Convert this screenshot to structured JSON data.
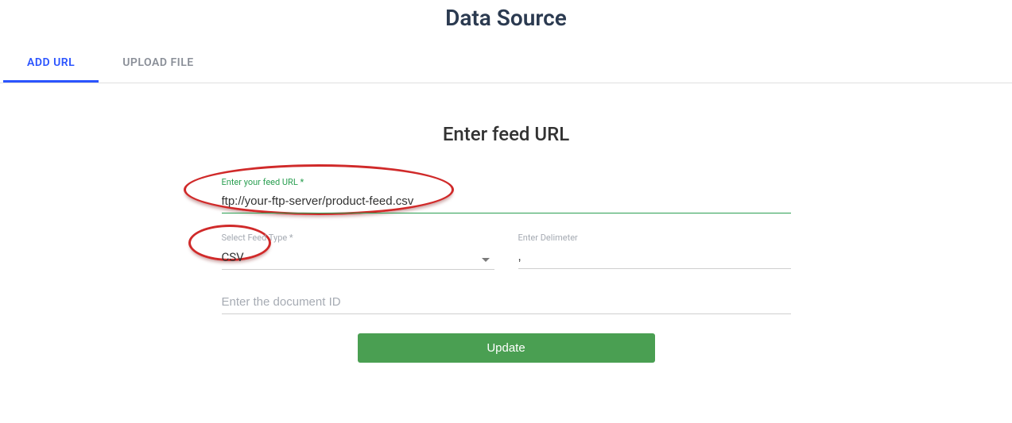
{
  "page_title": "Data Source",
  "tabs": [
    {
      "label": "ADD URL",
      "active": true
    },
    {
      "label": "UPLOAD FILE",
      "active": false
    }
  ],
  "section_title": "Enter feed URL",
  "form": {
    "feed_url": {
      "label": "Enter your feed URL *",
      "value": "ftp://your-ftp-server/product-feed.csv"
    },
    "feed_type": {
      "label": "Select Feed Type *",
      "value": "CSV"
    },
    "delimiter": {
      "label": "Enter Delimeter",
      "value": ","
    },
    "document_id": {
      "placeholder": "Enter the document ID",
      "value": ""
    },
    "submit_label": "Update"
  },
  "annotations": {
    "ann1": "circle-annotation",
    "ann2": "circle-annotation"
  }
}
